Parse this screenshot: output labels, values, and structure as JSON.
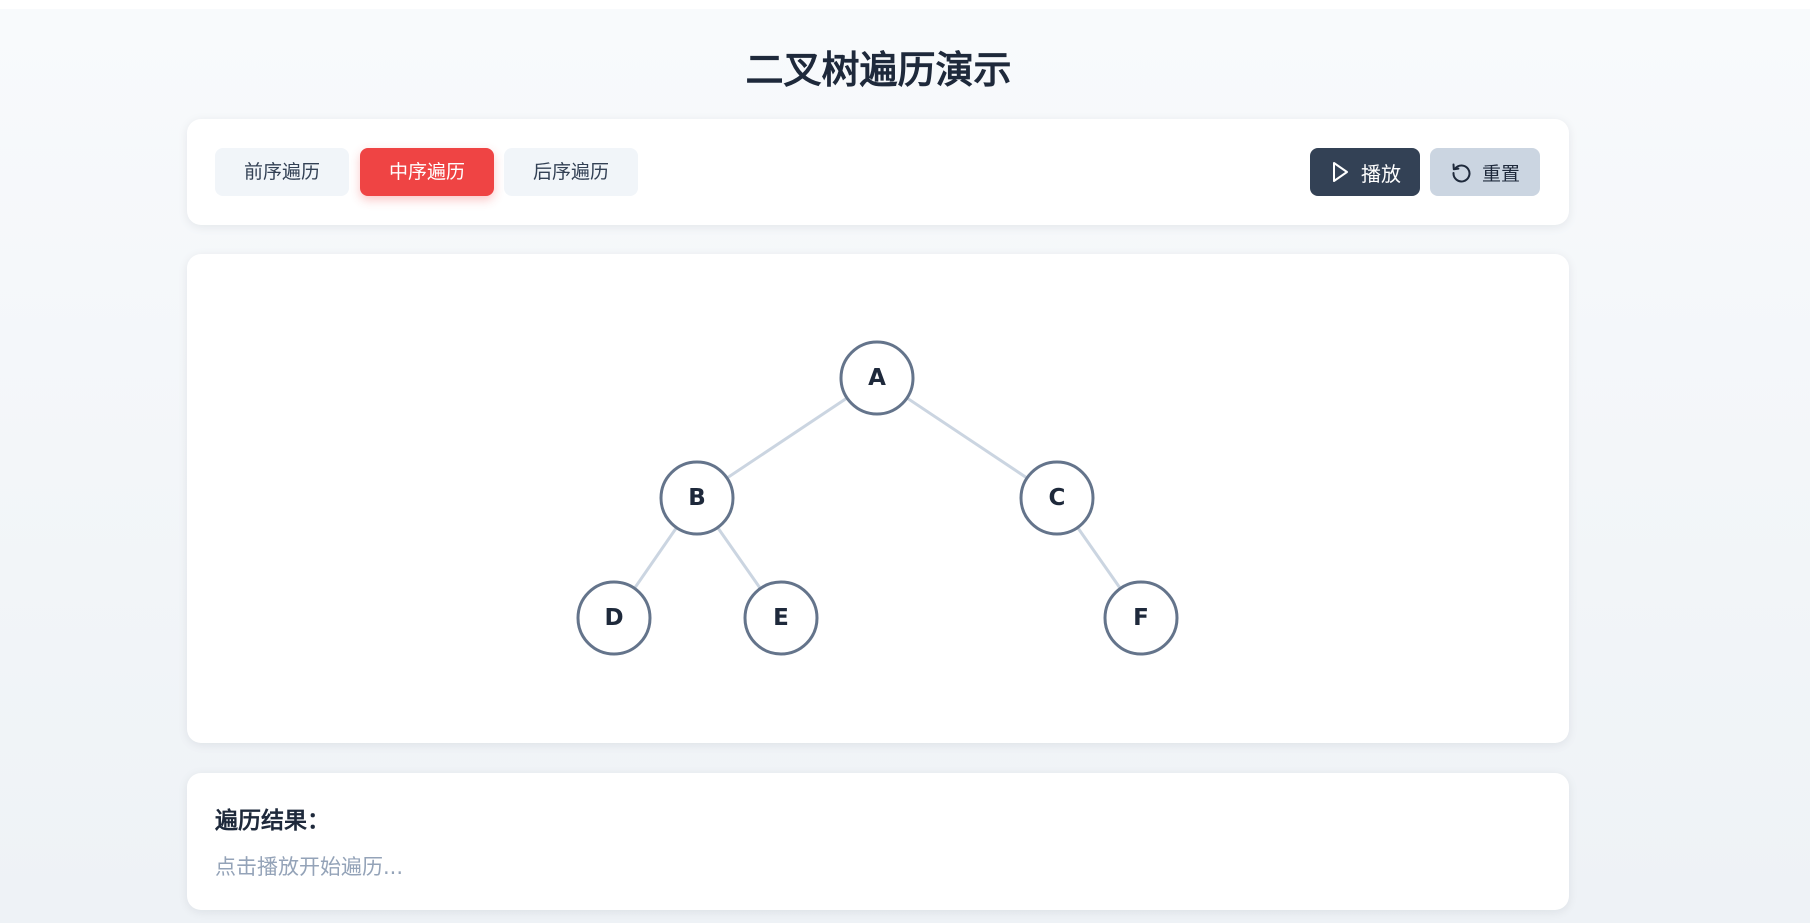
{
  "page": {
    "title": "二叉树遍历演示"
  },
  "toolbar": {
    "tabs": [
      {
        "label": "前序遍历",
        "active": false
      },
      {
        "label": "中序遍历",
        "active": true
      },
      {
        "label": "后序遍历",
        "active": false
      }
    ],
    "play_label": "播放",
    "reset_label": "重置",
    "active_color": "#ef4444",
    "play_color": "#334155",
    "reset_color": "#cbd5e1"
  },
  "tree": {
    "nodes": [
      {
        "id": "A",
        "label": "A"
      },
      {
        "id": "B",
        "label": "B"
      },
      {
        "id": "C",
        "label": "C"
      },
      {
        "id": "D",
        "label": "D"
      },
      {
        "id": "E",
        "label": "E"
      },
      {
        "id": "F",
        "label": "F"
      }
    ],
    "edges": [
      {
        "from": "A",
        "to": "B"
      },
      {
        "from": "A",
        "to": "C"
      },
      {
        "from": "B",
        "to": "D"
      },
      {
        "from": "B",
        "to": "E"
      },
      {
        "from": "C",
        "to": "F"
      }
    ]
  },
  "result": {
    "title": "遍历结果：",
    "placeholder": "点击播放开始遍历..."
  },
  "icons": {
    "play": "play-icon",
    "reset": "reset-icon"
  }
}
